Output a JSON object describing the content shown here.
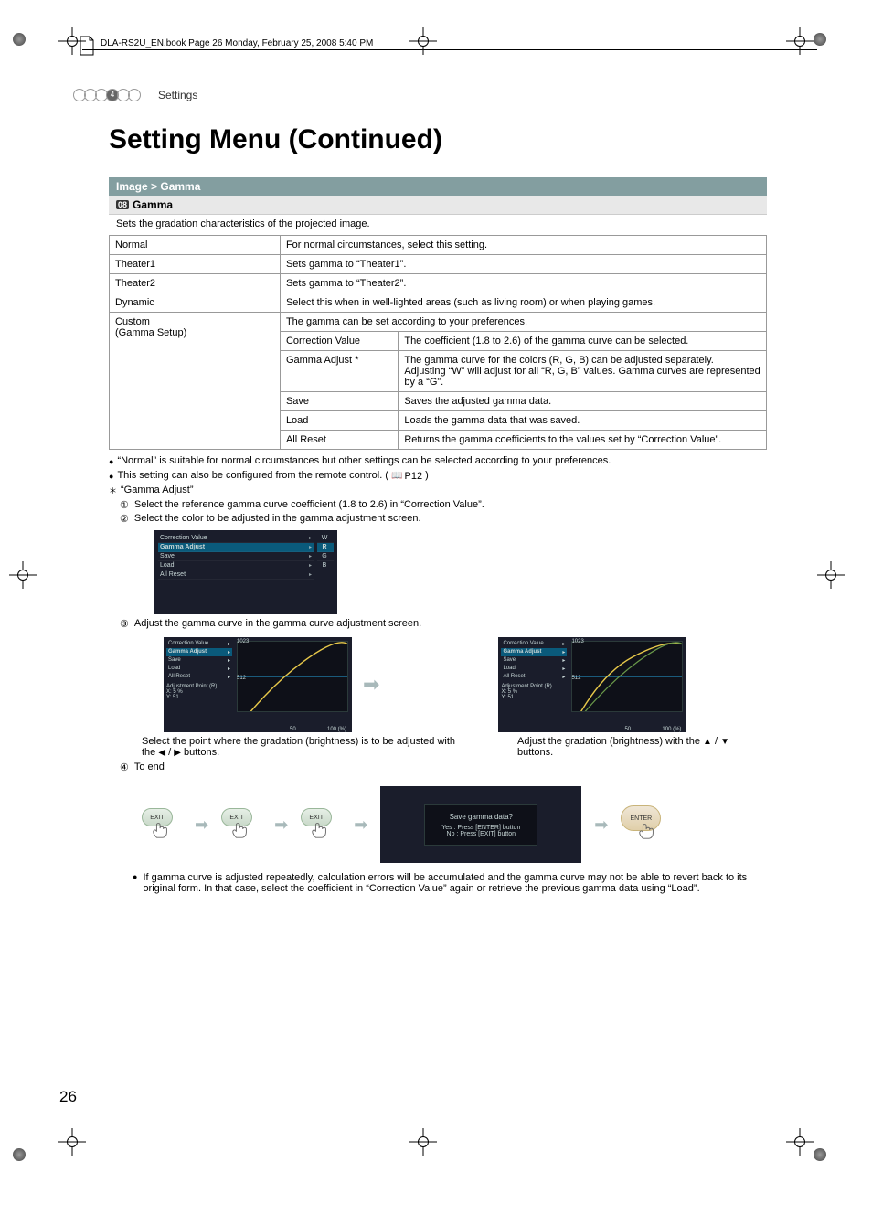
{
  "header": {
    "doc_line": "DLA-RS2U_EN.book  Page 26  Monday, February 25, 2008  5:40 PM"
  },
  "section": {
    "number": "4",
    "name": "Settings"
  },
  "title": "Setting Menu (Continued)",
  "breadcrumb": "Image > Gamma",
  "item": {
    "number": "08",
    "name": "Gamma",
    "desc": "Sets the gradation characteristics of the projected image."
  },
  "rows": {
    "normal": {
      "label": "Normal",
      "desc": "For normal circumstances, select this setting."
    },
    "theater1": {
      "label": "Theater1",
      "desc": "Sets gamma to “Theater1”."
    },
    "theater2": {
      "label": "Theater2",
      "desc": "Sets gamma to “Theater2”."
    },
    "dynamic": {
      "label": "Dynamic",
      "desc": "Select this when in well-lighted areas (such as living room) or when playing games."
    },
    "custom": {
      "label": "Custom\n(Gamma Setup)",
      "desc": "The gamma can be set according to your preferences.",
      "sub": {
        "correction": {
          "label": "Correction Value",
          "desc": "The coefficient (1.8 to 2.6) of the gamma curve can be selected."
        },
        "adjust": {
          "label": "Gamma Adjust *",
          "desc": "The gamma curve for the colors (R, G, B) can be adjusted separately.\nAdjusting “W” will adjust for all “R, G, B” values. Gamma curves are represented by a “G”."
        },
        "save": {
          "label": "Save",
          "desc": "Saves the adjusted gamma data."
        },
        "load": {
          "label": "Load",
          "desc": "Loads the gamma data that was saved."
        },
        "reset": {
          "label": "All Reset",
          "desc": "Returns the gamma coefficients to the values set by “Correction Value”."
        }
      }
    }
  },
  "bullets": {
    "b1": "“Normal” is suitable for normal circumstances but other settings can be selected according to your preferences.",
    "b2_a": "This setting can also be configured from the remote control. (",
    "b2_ref": "P12",
    "b2_b": ")",
    "star": "“Gamma Adjust”",
    "s1": "Select the reference gamma curve coefficient (1.8 to 2.6) in “Correction Value”.",
    "s2": "Select the color to be adjusted in the gamma adjustment screen.",
    "s3": "Adjust the gamma curve in the gamma curve adjustment screen.",
    "s4": "To end"
  },
  "menu1": {
    "r1": "Correction Value",
    "r1v": "",
    "r2": "Gamma Adjust",
    "r3": "Save",
    "r4": "Load",
    "r5": "All Reset",
    "optW": "W",
    "optR": "R",
    "optG": "G",
    "optB": "B"
  },
  "curve": {
    "left_rows": {
      "r1": "Correction Value",
      "r2": "Gamma Adjust",
      "r3": "Save",
      "r4": "Load",
      "r5": "All Reset",
      "r6a": "Adjustment Point (R)",
      "xlabel": "X:",
      "xval": "5 %",
      "ylabel": "Y:",
      "yval": "51"
    },
    "nums": {
      "n1023": "1023",
      "n512": "512",
      "n50": "50",
      "n100": "100 (%)"
    }
  },
  "captions": {
    "c1a": "Select the point where the gradation (brightness) is to be adjusted with the ",
    "c1b": " buttons.",
    "c2a": "Adjust the gradation (brightness) with the ",
    "c2b": " buttons."
  },
  "buttons": {
    "exit": "EXIT",
    "enter": "ENTER"
  },
  "dialog": {
    "q": "Save gamma data?",
    "yes": "Yes  :  Press [ENTER] button",
    "no": "No   :  Press [EXIT] button"
  },
  "final_note": "If gamma curve is adjusted repeatedly, calculation errors will be accumulated and the gamma curve may not be able to revert back to its original form. In that case, select the coefficient in “Correction Value” again or retrieve the previous gamma data using “Load”.",
  "page_number": "26",
  "glyphs": {
    "left": "◀",
    "right": "▶",
    "up": "▲",
    "down": "▼",
    "slash": " / "
  }
}
